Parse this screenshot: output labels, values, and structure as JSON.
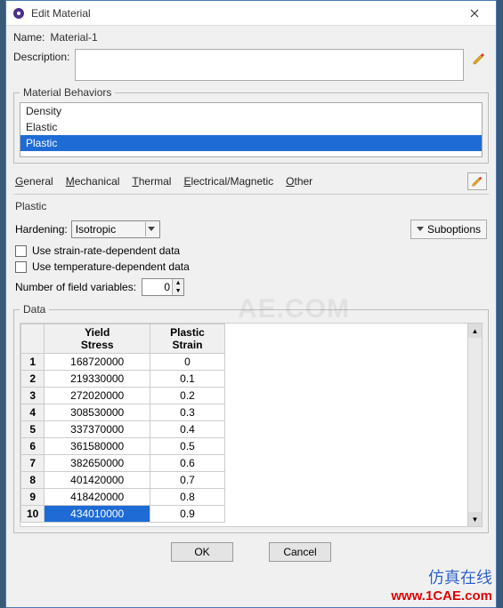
{
  "window": {
    "title": "Edit Material"
  },
  "form": {
    "name_label": "Name:",
    "name_value": "Material-1",
    "description_label": "Description:"
  },
  "behaviors": {
    "legend": "Material Behaviors",
    "items": [
      "Density",
      "Elastic",
      "Plastic"
    ],
    "selected_index": 2
  },
  "menu": {
    "general": "General",
    "mechanical": "Mechanical",
    "thermal": "Thermal",
    "electrical": "Electrical/Magnetic",
    "other": "Other"
  },
  "plastic": {
    "section_label": "Plastic",
    "hardening_label": "Hardening:",
    "hardening_value": "Isotropic",
    "suboptions_label": "Suboptions",
    "strain_rate_chk": "Use strain-rate-dependent data",
    "temp_chk": "Use temperature-dependent data",
    "field_vars_label": "Number of field variables:",
    "field_vars_value": "0"
  },
  "data": {
    "legend": "Data",
    "columns": [
      "Yield\nStress",
      "Plastic\nStrain"
    ],
    "rows": [
      [
        "168720000",
        "0"
      ],
      [
        "219330000",
        "0.1"
      ],
      [
        "272020000",
        "0.2"
      ],
      [
        "308530000",
        "0.3"
      ],
      [
        "337370000",
        "0.4"
      ],
      [
        "361580000",
        "0.5"
      ],
      [
        "382650000",
        "0.6"
      ],
      [
        "401420000",
        "0.7"
      ],
      [
        "418420000",
        "0.8"
      ],
      [
        "434010000",
        "0.9"
      ]
    ],
    "selected_cell": {
      "row": 9,
      "col": 0
    }
  },
  "buttons": {
    "ok": "OK",
    "cancel": "Cancel"
  },
  "watermark": {
    "big": "AE.COM",
    "cn": "仿真在线",
    "url": "www.1CAE.com"
  }
}
